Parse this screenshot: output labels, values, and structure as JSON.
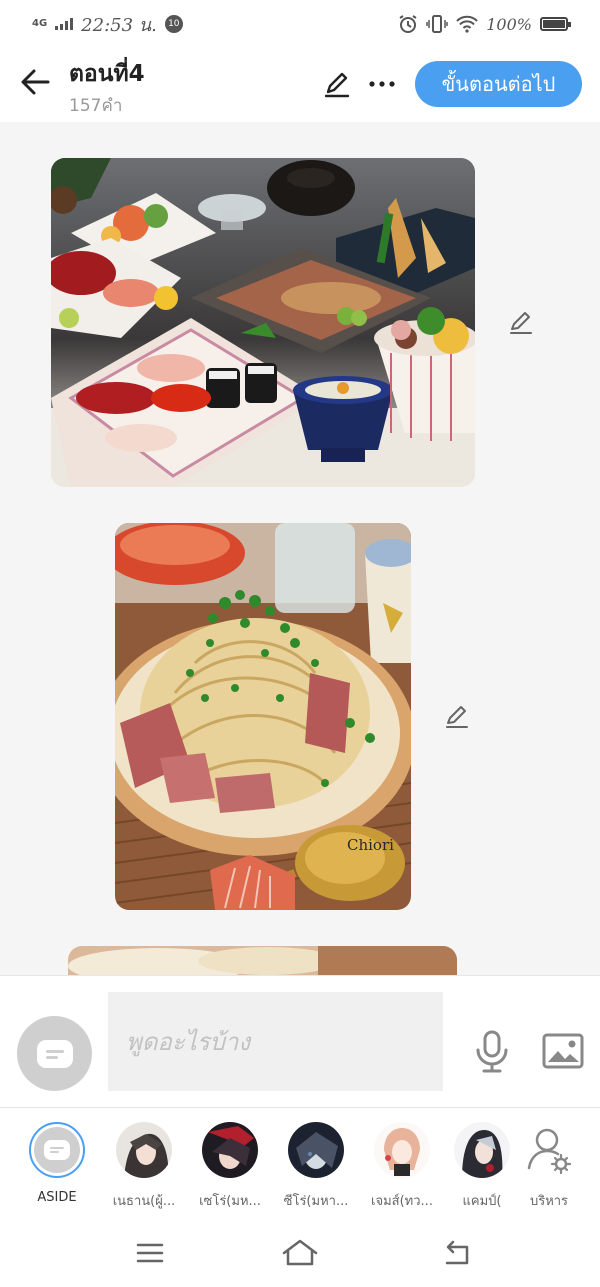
{
  "status_bar": {
    "network": "4G",
    "time": "22:53 น.",
    "notification_count": "10",
    "battery": "100%",
    "battery_level": 1.0
  },
  "header": {
    "title": "ตอนที่4",
    "word_count": "157คำ",
    "next_button": "ขั้นตอนต่อไป"
  },
  "images": [
    {
      "name": "japanese-dinner-photo",
      "alt": "Japanese dinner set with sushi and sashimi"
    },
    {
      "name": "carbonara-photo",
      "alt": "Carbonara pasta with bacon and green onion",
      "watermark": "Chiori"
    },
    {
      "name": "partial-photo",
      "alt": "Partially visible photo"
    }
  ],
  "composer": {
    "placeholder": "พูดอะไรบ้าง"
  },
  "characters": [
    {
      "label": "ASIDE",
      "active": true
    },
    {
      "label": "เนธาน(ผู้..."
    },
    {
      "label": "เซโร่(มห..."
    },
    {
      "label": "ซีโร่(มหา..."
    },
    {
      "label": "เจมส์(ทว..."
    },
    {
      "label": "แคมป์("
    },
    {
      "label": "บริหาร"
    }
  ],
  "colors": {
    "accent": "#4a9ff0",
    "background": "#f5f5f5"
  }
}
